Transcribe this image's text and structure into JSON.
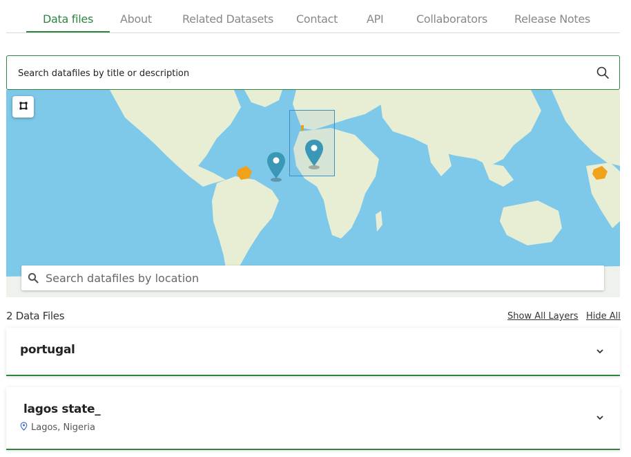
{
  "tabs": [
    {
      "label": "Data files",
      "active": true
    },
    {
      "label": "About"
    },
    {
      "label": "Related Datasets"
    },
    {
      "label": "Contact"
    },
    {
      "label": "API"
    },
    {
      "label": "Collaborators"
    },
    {
      "label": "Release Notes"
    }
  ],
  "search": {
    "placeholder": "Search datafiles by title or description",
    "icon": "search-icon"
  },
  "map": {
    "location_search": {
      "placeholder": "Search datafiles by location",
      "icon": "search-icon"
    },
    "draw_tool_icon": "draw-rectangle-icon",
    "marker_icon": "map-pin-icon",
    "colors": {
      "ocean": "#7ec9ea",
      "land": "#e7eed4",
      "highlight": "#f0a21a",
      "marker": "#3b97b6"
    }
  },
  "results": {
    "count_label": "2 Data Files",
    "show_all_layers": "Show All Layers",
    "hide_all": "Hide All"
  },
  "files": [
    {
      "title": "portugal"
    },
    {
      "title": "lagos state_",
      "location": "Lagos, Nigeria",
      "location_icon": "location-pin-icon"
    }
  ],
  "accent_color": "#2e8540"
}
